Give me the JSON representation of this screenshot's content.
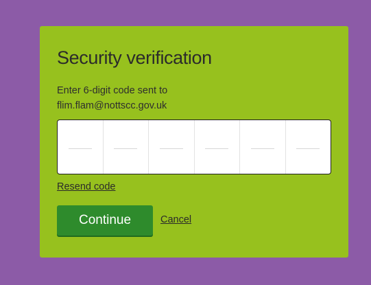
{
  "dialog": {
    "title": "Security verification",
    "instruction_line1": "Enter 6-digit code sent to",
    "instruction_line2": "flim.flam@nottscc.gov.uk",
    "code_digits": [
      "",
      "",
      "",
      "",
      "",
      ""
    ],
    "resend_label": "Resend code",
    "continue_label": "Continue",
    "cancel_label": "Cancel"
  },
  "colors": {
    "page_background": "#8c5ba7",
    "card_background": "#97c11e",
    "continue_button": "#2e8b2c"
  }
}
